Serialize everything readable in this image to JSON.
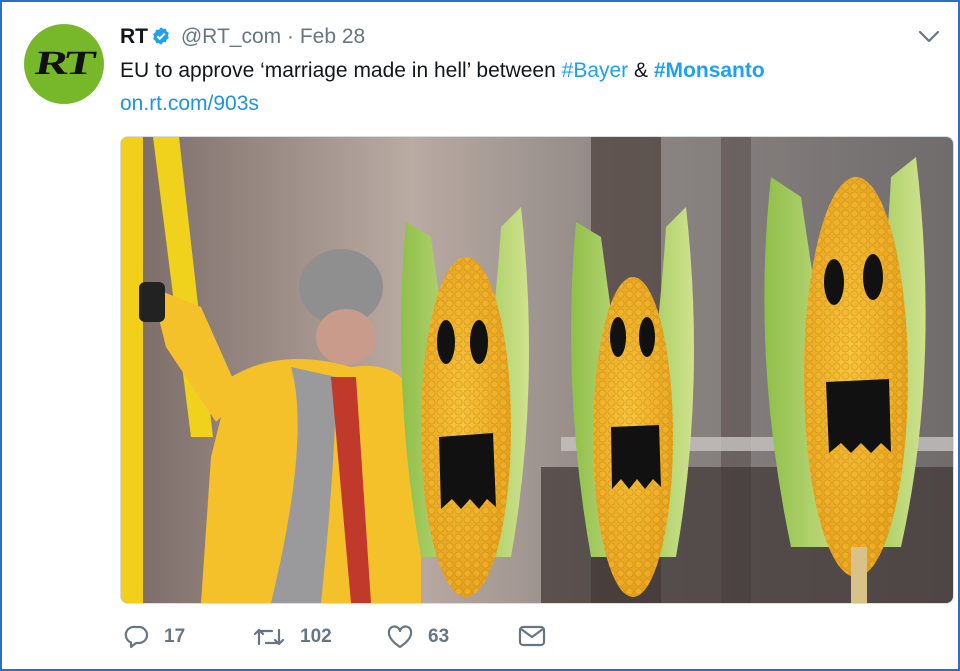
{
  "tweet": {
    "account_name": "RT",
    "handle": "@RT_com",
    "separator": "·",
    "date": "Feb 28",
    "avatar_text": "RT",
    "text_before": "EU to approve ‘marriage made in hell’ between ",
    "hashtag_1": "#Bayer",
    "text_middle": " & ",
    "hashtag_2": "#Monsanto",
    "link": "on.rt.com/903s"
  },
  "actions": {
    "reply_count": "17",
    "retweet_count": "102",
    "like_count": "63"
  },
  "icons": [
    "verified-badge-icon",
    "chevron-down-icon",
    "reply-icon",
    "retweet-icon",
    "like-icon",
    "direct-message-icon"
  ],
  "colors": {
    "accent": "#1da1f2",
    "frame_border": "#2a6fc9",
    "avatar_bg": "#77b82a",
    "muted_text": "#657786"
  }
}
